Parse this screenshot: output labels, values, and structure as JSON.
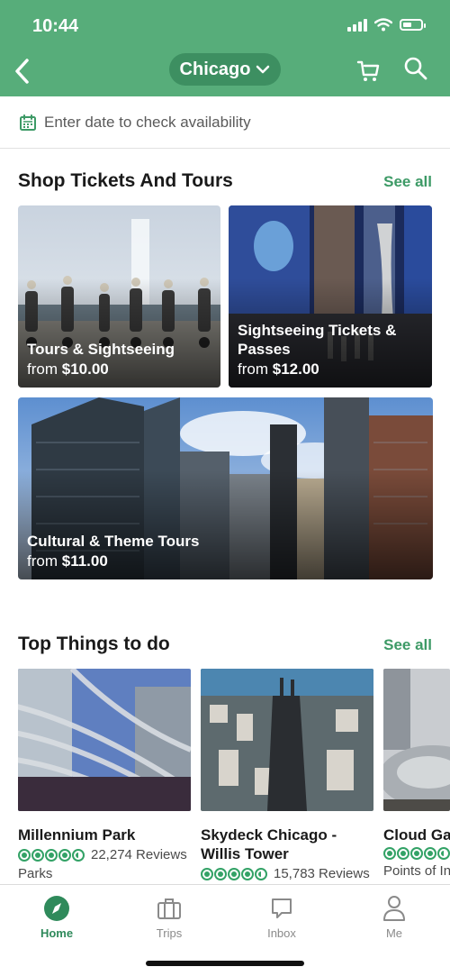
{
  "status": {
    "time": "10:44"
  },
  "header": {
    "city": "Chicago"
  },
  "date_bar": {
    "placeholder": "Enter date to check availability"
  },
  "shop": {
    "title": "Shop Tickets And Tours",
    "see_all": "See all",
    "cards": [
      {
        "title": "Tours & Sightseeing",
        "from": "from",
        "price": "$10.00"
      },
      {
        "title": "Sightseeing Tickets & Passes",
        "from": "from",
        "price": "$12.00"
      },
      {
        "title": "Cultural & Theme Tours",
        "from": "from",
        "price": "$11.00"
      }
    ]
  },
  "things": {
    "title": "Top Things to do",
    "see_all": "See all",
    "items": [
      {
        "name": "Millennium Park",
        "rating": 4.5,
        "reviews": "22,274 Reviews",
        "category": "Parks"
      },
      {
        "name": "Skydeck Chicago - Willis Tower",
        "rating": 4.5,
        "reviews": "15,783 Reviews",
        "category": ""
      },
      {
        "name": "Cloud Ga",
        "rating": 4.5,
        "reviews": "",
        "category": "Points of In"
      }
    ]
  },
  "tabs": [
    {
      "label": "Home",
      "icon": "compass-icon"
    },
    {
      "label": "Trips",
      "icon": "suitcase-icon"
    },
    {
      "label": "Inbox",
      "icon": "chat-icon"
    },
    {
      "label": "Me",
      "icon": "person-icon"
    }
  ],
  "colors": {
    "brand": "#57ad7a",
    "accent": "#3d9a66",
    "rating": "#33a266"
  }
}
